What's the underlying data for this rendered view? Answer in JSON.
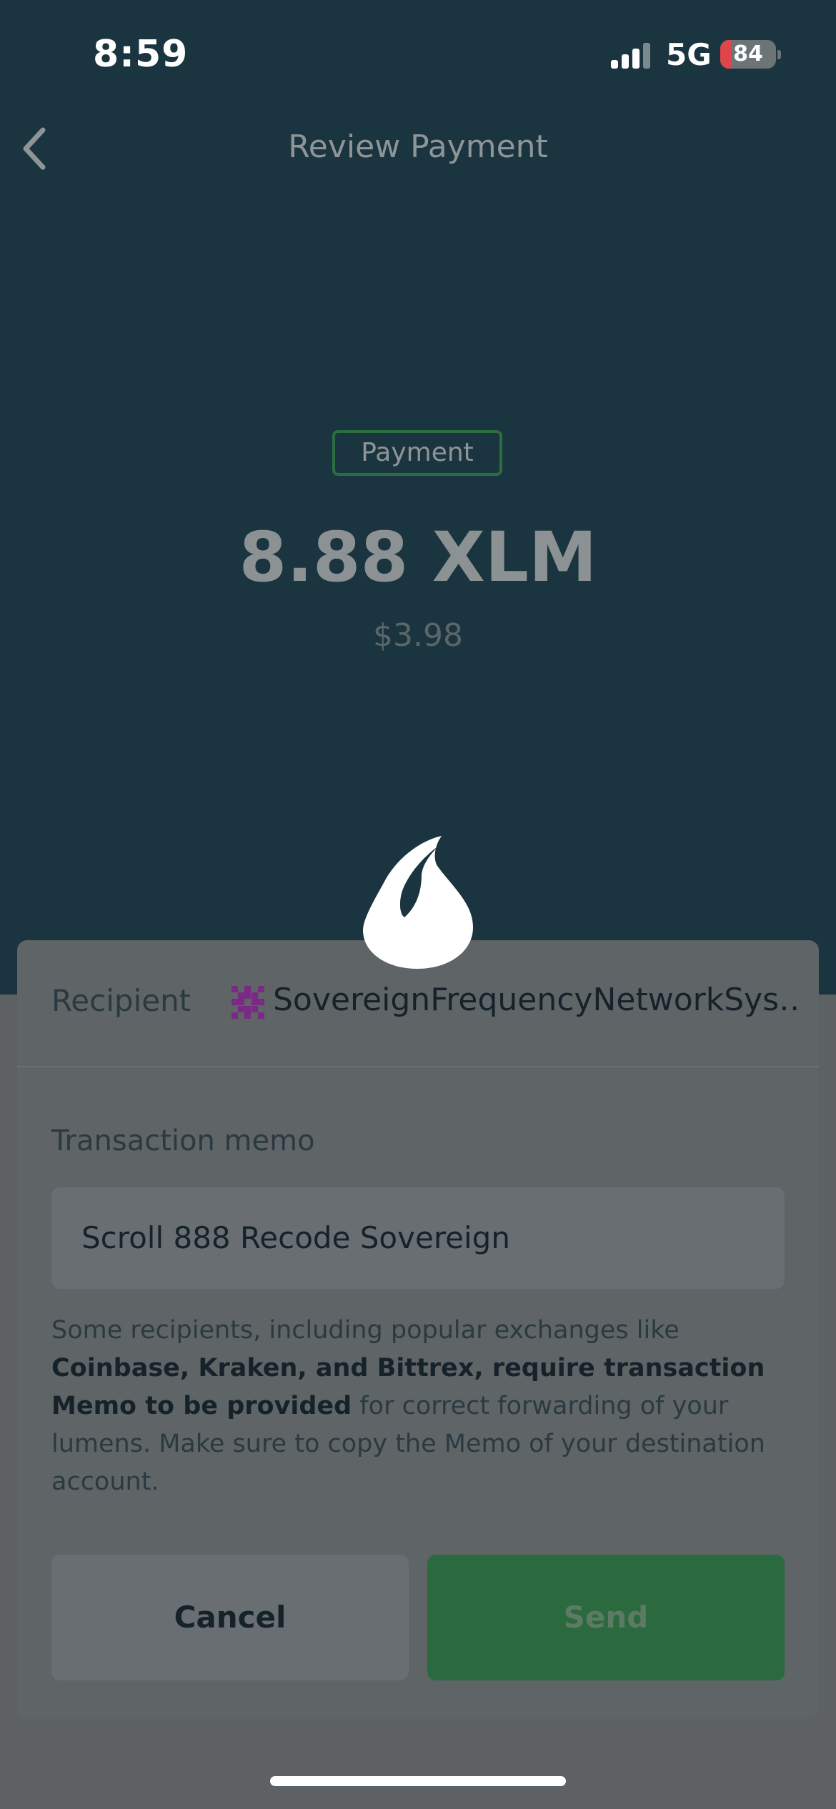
{
  "status_bar": {
    "time": "8:59",
    "network": "5G",
    "battery_level": "84",
    "battery_fraction": 0.21,
    "signal_bars_active": 3,
    "signal_bars_total": 4
  },
  "header": {
    "title": "Review Payment",
    "back_icon": "chevron-left-icon"
  },
  "transaction": {
    "type_badge": "Payment",
    "amount": "8.88 XLM",
    "fiat_amount": "$3.98"
  },
  "logo": {
    "icon": "drop-logo-icon"
  },
  "recipient": {
    "label": "Recipient",
    "name": "SovereignFrequencyNetworkSys…",
    "avatar_icon": "identicon-avatar"
  },
  "memo": {
    "label": "Transaction memo",
    "value": "Scroll 888 Recode Sovereign",
    "notice_intro": "Some recipients, including popular exchanges like ",
    "notice_bold": "Coinbase, Kraken, and Bittrex, require transaction Memo to be provided",
    "notice_outro": " for correct forwarding of your lumens. Make sure to copy the Memo of your destination account."
  },
  "actions": {
    "cancel_label": "Cancel",
    "send_label": "Send"
  },
  "colors": {
    "header_bg": "#1a3540",
    "sheet_bg": "#5f6467",
    "send_button": "#2a6a3e",
    "badge_border": "#2d6e41",
    "identicon": "#7a2a84"
  }
}
